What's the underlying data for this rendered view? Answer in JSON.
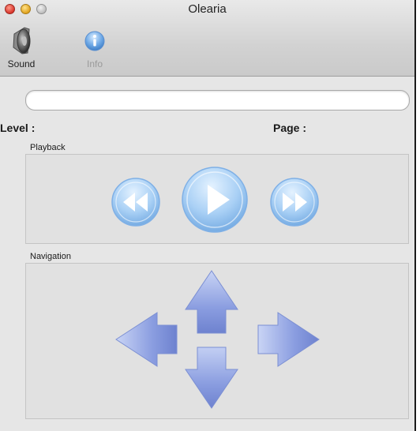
{
  "window": {
    "title": "Olearia",
    "buttons": {
      "close_color": "#d8342a",
      "minimize_color": "#e0a21d",
      "zoom_color": "#bdbdbd"
    }
  },
  "toolbar": {
    "items": [
      {
        "label": "Sound",
        "icon": "speaker-icon",
        "enabled": true
      },
      {
        "label": "Info",
        "icon": "info-icon",
        "enabled": false
      }
    ]
  },
  "progress": {
    "value": 0
  },
  "status": {
    "level_label": "Level :",
    "page_label": "Page :"
  },
  "playback": {
    "title": "Playback",
    "buttons": [
      "rewind-icon",
      "play-icon",
      "fast-forward-icon"
    ]
  },
  "navigation": {
    "title": "Navigation",
    "buttons": [
      "arrow-up-icon",
      "arrow-left-icon",
      "arrow-right-icon",
      "arrow-down-icon"
    ]
  },
  "colors": {
    "button_blue": "#9cc6f0",
    "arrow_blue": "#8a9de0",
    "panel_gray": "#e1e1e1"
  }
}
